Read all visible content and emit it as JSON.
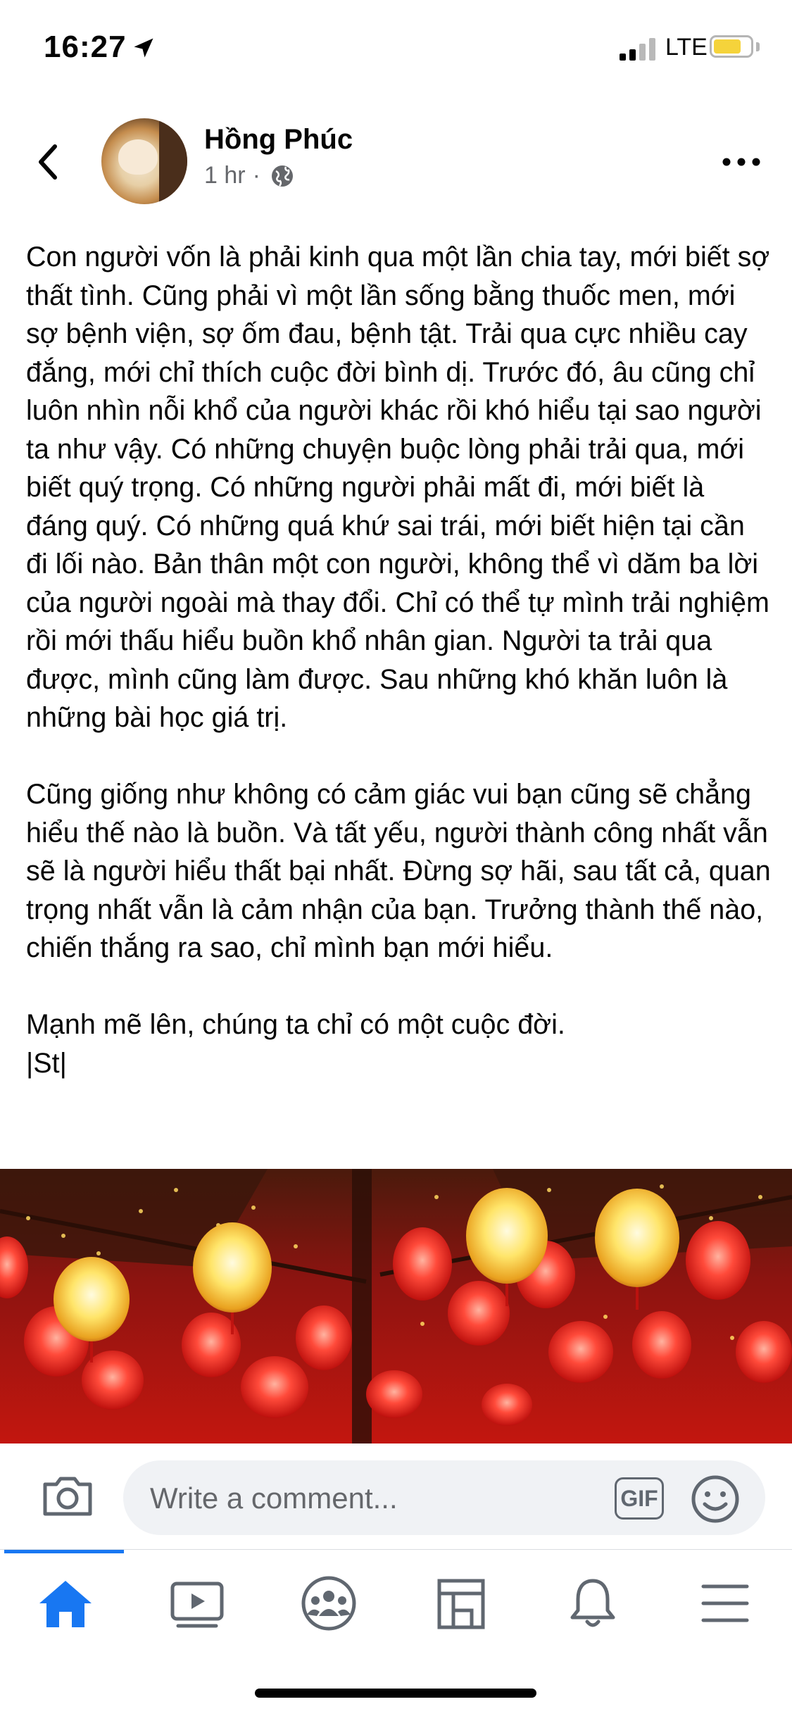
{
  "status_bar": {
    "time": "16:27",
    "network": "LTE",
    "battery_level": 0.75,
    "battery_color": "#f5d33b"
  },
  "post": {
    "author": "Hồng Phúc",
    "time_ago": "1 hr",
    "separator": "·",
    "text": "Con người vốn là phải kinh qua một lần chia tay, mới biết sợ thất tình. Cũng phải vì một lần sống bằng thuốc men, mới sợ bệnh viện, sợ ốm đau, bệnh tật. Trải qua cực nhiều cay đắng, mới chỉ thích cuộc đời bình dị. Trước đó, âu cũng chỉ luôn nhìn nỗi khổ của người khác rồi khó hiểu tại sao người ta như vậy. Có những chuyện buộc lòng phải trải qua, mới biết quý trọng. Có những người phải mất đi, mới biết là đáng quý. Có những quá khứ sai trái, mới biết hiện tại cần đi lối nào. Bản thân một con người, không thể vì dăm ba lời của người ngoài mà thay đổi. Chỉ có thể tự mình trải nghiệm rồi mới thấu hiểu buồn khổ nhân gian. Người ta trải qua được, mình cũng làm được. Sau những khó khăn luôn là những bài học giá trị.\n\nCũng giống như không có cảm giác vui bạn cũng sẽ chẳng hiểu thế nào là buồn. Và tất yếu, người thành công nhất vẫn sẽ là người hiểu thất bại nhất. Đừng sợ hãi, sau tất cả, quan trọng nhất vẫn là cảm nhận của bạn. Trưởng thành thế nào, chiến thắng ra sao, chỉ mình bạn mới hiểu.\n\nMạnh mẽ lên, chúng ta chỉ có một cuộc đời.\n|St|"
  },
  "comment": {
    "placeholder": "Write a comment...",
    "gif_label": "GIF"
  },
  "tabs": [
    {
      "icon": "home-icon",
      "active": true
    },
    {
      "icon": "watch-icon",
      "active": false
    },
    {
      "icon": "groups-icon",
      "active": false
    },
    {
      "icon": "marketplace-icon",
      "active": false
    },
    {
      "icon": "bell-icon",
      "active": false
    },
    {
      "icon": "menu-icon",
      "active": false
    }
  ],
  "colors": {
    "accent": "#1877f2",
    "icon_gray": "#606770",
    "meta_gray": "#65676b"
  }
}
